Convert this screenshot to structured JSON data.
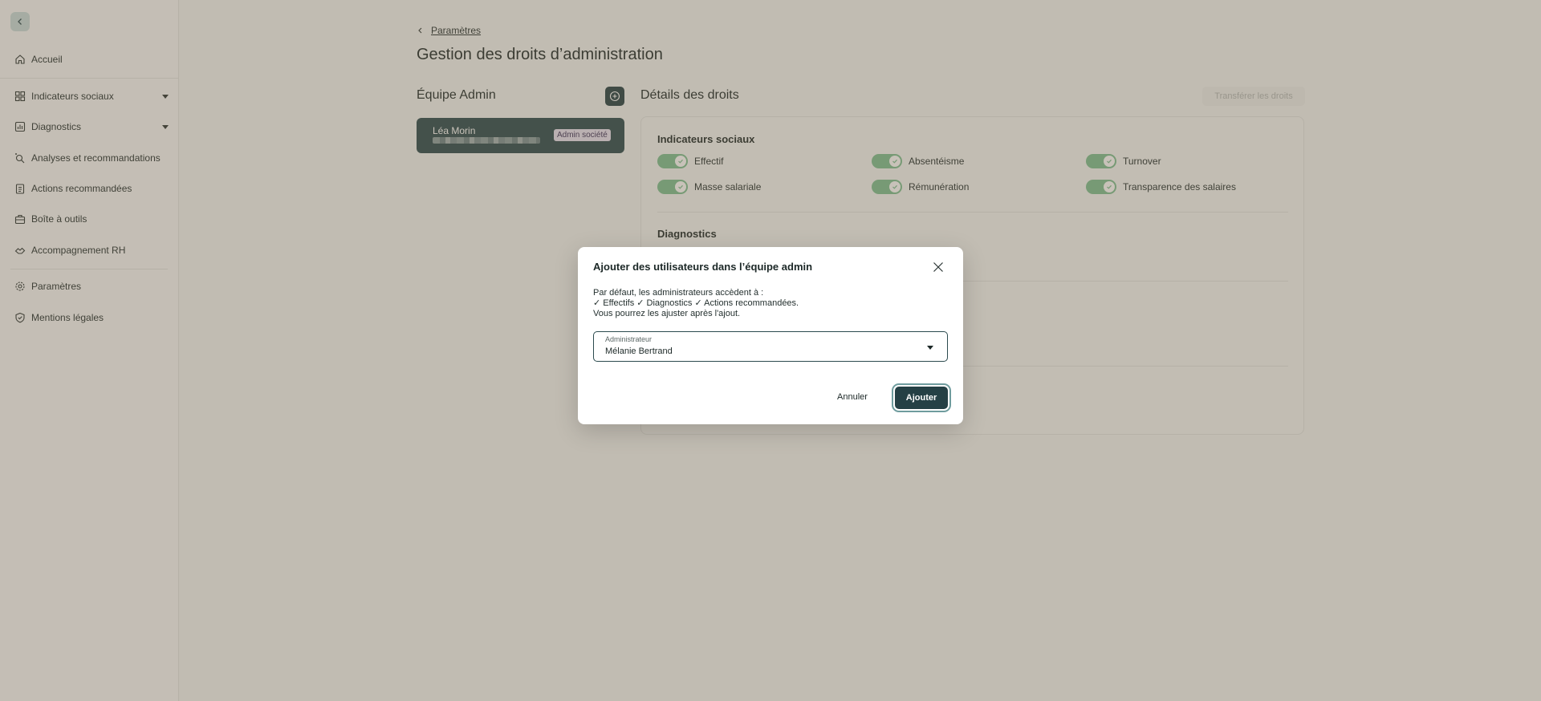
{
  "sidebar": {
    "items": [
      {
        "label": "Accueil",
        "icon": "home-icon"
      },
      {
        "label": "Indicateurs sociaux",
        "icon": "grid-icon"
      },
      {
        "label": "Diagnostics",
        "icon": "bar-chart-icon"
      },
      {
        "label": "Analyses et recommandations",
        "icon": "search-sparkle-icon"
      },
      {
        "label": "Actions recommandées",
        "icon": "clipboard-icon"
      },
      {
        "label": "Boîte à outils",
        "icon": "toolbox-icon"
      },
      {
        "label": "Accompagnement RH",
        "icon": "handshake-icon"
      },
      {
        "label": "Paramètres",
        "icon": "gear-icon"
      },
      {
        "label": "Mentions légales",
        "icon": "shield-check-icon"
      }
    ]
  },
  "breadcrumb": {
    "back_label": "Paramètres"
  },
  "page": {
    "title": "Gestion des droits d’administration"
  },
  "team": {
    "title": "Équipe Admin",
    "members": [
      {
        "name": "Léa Morin",
        "badge": "Admin société"
      }
    ]
  },
  "details": {
    "title": "Détails des droits",
    "transfer_label": "Transférer les droits",
    "sections": [
      {
        "title": "Indicateurs sociaux",
        "permissions": [
          "Effectif",
          "Absentéisme",
          "Turnover",
          "Masse salariale",
          "Rémunération",
          "Transparence des salaires"
        ]
      },
      {
        "title": "Diagnostics"
      }
    ]
  },
  "modal": {
    "title": "Ajouter des utilisateurs dans l’équipe admin",
    "text_line1": "Par défaut, les administrateurs accèdent à :",
    "text_line2": "✓ Effectifs ✓ Diagnostics ✓ Actions recommandées.",
    "text_line3": "Vous pourrez les ajuster après l'ajout.",
    "select_label": "Administrateur",
    "select_value": "Mélanie Bertrand",
    "cancel_label": "Annuler",
    "submit_label": "Ajouter"
  },
  "colors": {
    "primary": "#254045",
    "card": "#2b4a4e",
    "toggle_on": "#7cbf91",
    "badge_bg": "#e9e3f2",
    "overlay": "rgba(110,95,70,0.38)"
  }
}
